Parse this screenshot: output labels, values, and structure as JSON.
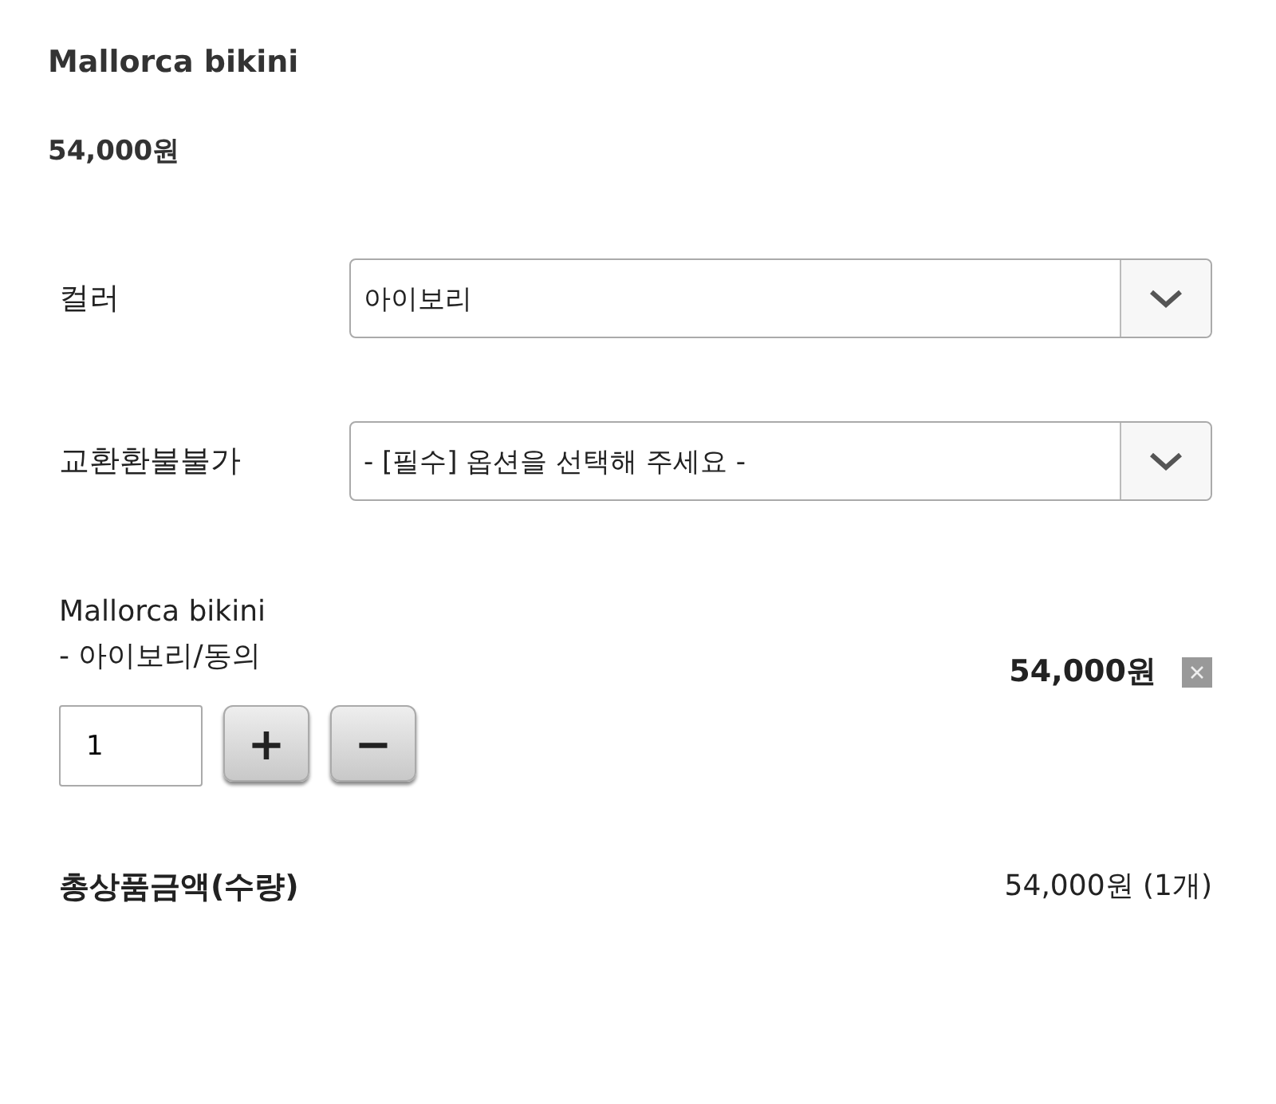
{
  "product": {
    "title": "Mallorca bikini",
    "price": "54,000원"
  },
  "options": [
    {
      "label": "컬러",
      "value": "아이보리"
    },
    {
      "label": "교환환불불가",
      "value": "- [필수] 옵션을 선택해 주세요 -"
    }
  ],
  "selected_item": {
    "name": "Mallorca bikini",
    "option": "- 아이보리/동의",
    "quantity": "1",
    "plus": "+",
    "minus": "−",
    "price": "54,000원"
  },
  "total": {
    "label": "총상품금액(수량)",
    "value": "54,000원 (1개)"
  }
}
